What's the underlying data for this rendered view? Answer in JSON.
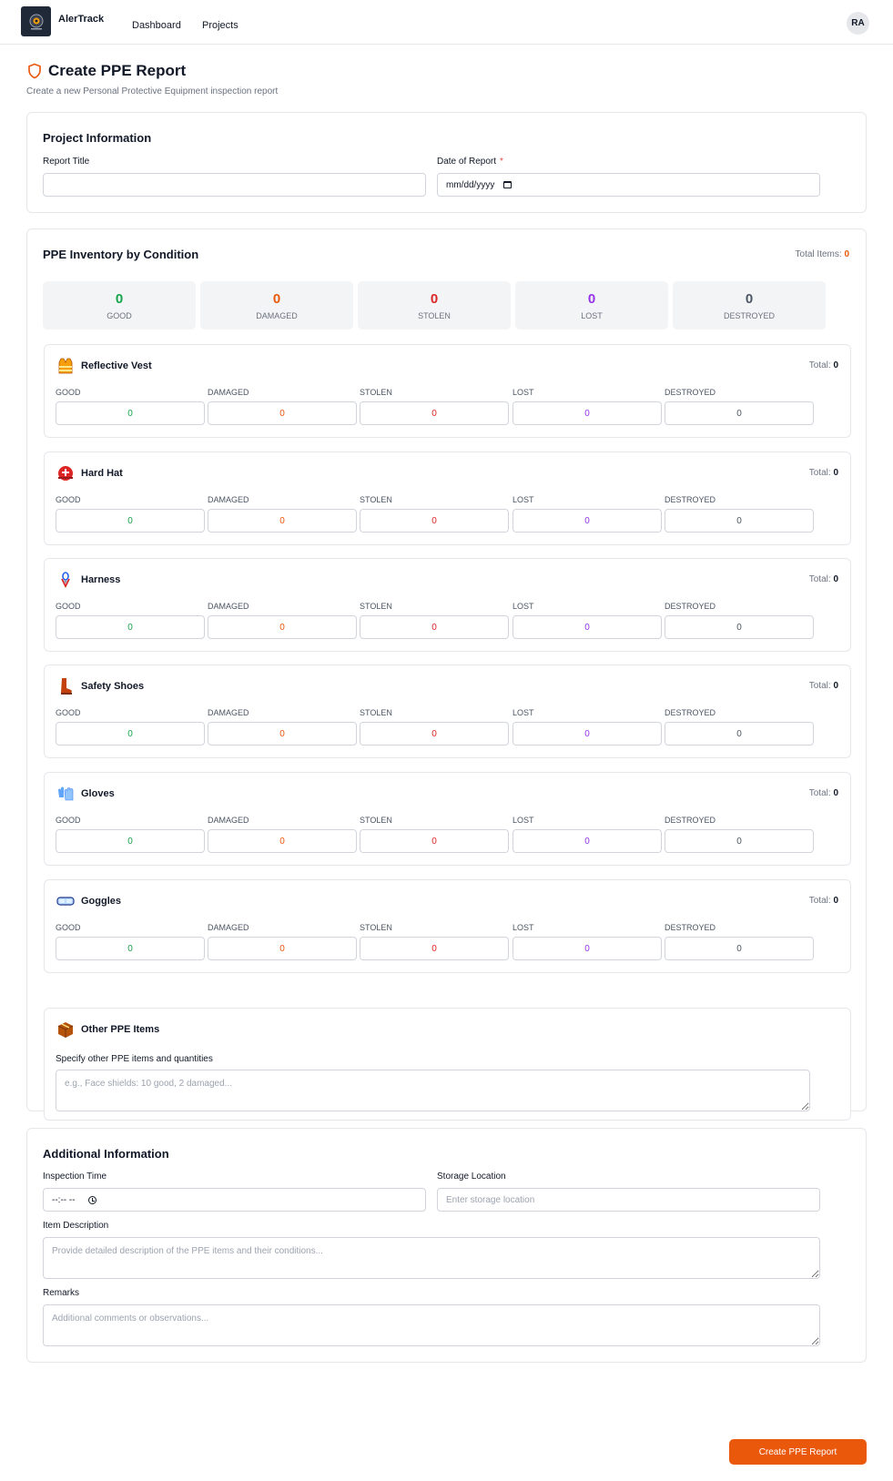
{
  "nav": {
    "brand": "AlerTrack",
    "links": [
      "Dashboard",
      "Projects"
    ],
    "avatar": "RA"
  },
  "header": {
    "title": "Create PPE Report",
    "subtitle": "Create a new Personal Protective Equipment inspection report",
    "icon": "shield-icon"
  },
  "project_info": {
    "title": "Project Information",
    "report_title_label": "Report Title",
    "report_title_value": "",
    "date_label": "Date of Report",
    "required_mark": "*",
    "date_placeholder": "mm/dd/yyyy"
  },
  "inventory": {
    "title": "PPE Inventory by Condition",
    "total_items_label": "Total Items:",
    "total_items_value": "0",
    "summary": [
      {
        "label": "GOOD",
        "value": "0",
        "color": "#16a34a"
      },
      {
        "label": "DAMAGED",
        "value": "0",
        "color": "#ea580c"
      },
      {
        "label": "STOLEN",
        "value": "0",
        "color": "#dc2626"
      },
      {
        "label": "LOST",
        "value": "0",
        "color": "#9333ea"
      },
      {
        "label": "DESTROYED",
        "value": "0",
        "color": "#4b5563"
      }
    ],
    "total_label": "Total:",
    "condition_labels": [
      "GOOD",
      "DAMAGED",
      "STOLEN",
      "LOST",
      "DESTROYED"
    ],
    "items": [
      {
        "name": "Reflective Vest",
        "icon": "vest-icon",
        "total": "0",
        "values": [
          "0",
          "0",
          "0",
          "0",
          "0"
        ]
      },
      {
        "name": "Hard Hat",
        "icon": "hard-hat-icon",
        "total": "0",
        "values": [
          "0",
          "0",
          "0",
          "0",
          "0"
        ]
      },
      {
        "name": "Harness",
        "icon": "harness-icon",
        "total": "0",
        "values": [
          "0",
          "0",
          "0",
          "0",
          "0"
        ]
      },
      {
        "name": "Safety Shoes",
        "icon": "boot-icon",
        "total": "0",
        "values": [
          "0",
          "0",
          "0",
          "0",
          "0"
        ]
      },
      {
        "name": "Gloves",
        "icon": "gloves-icon",
        "total": "0",
        "values": [
          "0",
          "0",
          "0",
          "0",
          "0"
        ]
      },
      {
        "name": "Goggles",
        "icon": "goggles-icon",
        "total": "0",
        "values": [
          "0",
          "0",
          "0",
          "0",
          "0"
        ]
      }
    ],
    "other": {
      "title": "Other PPE Items",
      "icon": "package-icon",
      "label": "Specify other PPE items and quantities",
      "placeholder": "e.g., Face shields: 10 good, 2 damaged..."
    }
  },
  "additional": {
    "title": "Additional Information",
    "inspection_time_label": "Inspection Time",
    "inspection_time_placeholder": "--:-- --",
    "storage_label": "Storage Location",
    "storage_placeholder": "Enter storage location",
    "description_label": "Item Description",
    "description_placeholder": "Provide detailed description of the PPE items and their conditions...",
    "remarks_label": "Remarks",
    "remarks_placeholder": "Additional comments or observations..."
  },
  "submit_label": "Create PPE Report",
  "colors": {
    "accent": "#ea580c",
    "good": "#16a34a",
    "damaged": "#ea580c",
    "stolen": "#dc2626",
    "lost": "#9333ea",
    "destroyed": "#4b5563"
  }
}
